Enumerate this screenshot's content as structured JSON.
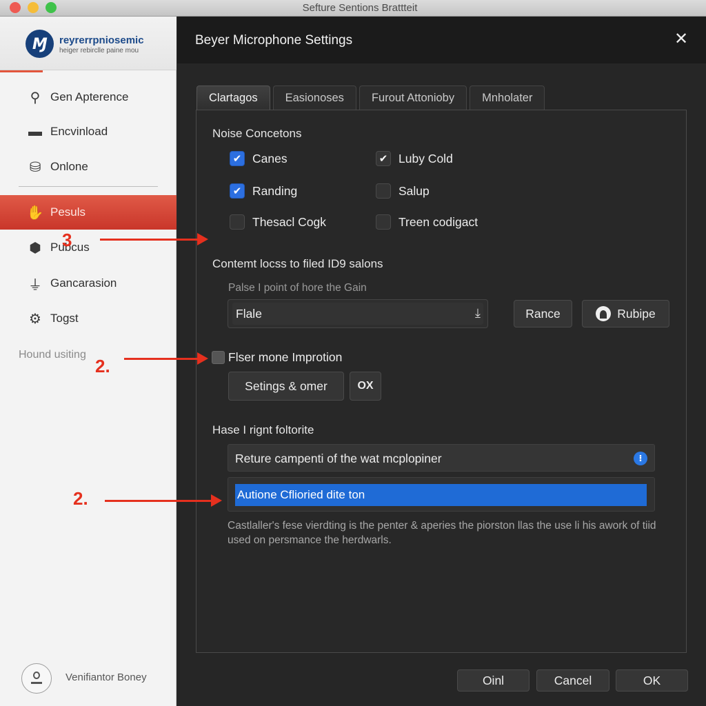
{
  "window": {
    "title": "Sefture Sentions Brattteit"
  },
  "sidebar": {
    "brand": {
      "logo_text": "Ɱ",
      "name": "reyrerrpniosemic",
      "tagline": "heiger rebirclle paine mou"
    },
    "items": [
      {
        "label": "Gen Apterence",
        "icon": "search-icon",
        "glyph": "⚲",
        "active": false
      },
      {
        "label": "Encvinload",
        "icon": "calendar-icon",
        "glyph": "▬",
        "active": false
      },
      {
        "label": "Onlone",
        "icon": "database-icon",
        "glyph": "⛁",
        "active": false
      },
      {
        "label": "Pesuls",
        "icon": "hand-icon",
        "glyph": "✋",
        "active": true
      },
      {
        "label": "Pubcus",
        "icon": "box-icon",
        "glyph": "⬢",
        "active": false
      },
      {
        "label": "Gancarasion",
        "icon": "microphone-icon",
        "glyph": "⏚",
        "active": false
      },
      {
        "label": "Togst",
        "icon": "gear-icon",
        "glyph": "⚙",
        "active": false
      }
    ],
    "muted_label": "Hound usiting",
    "user": {
      "name": "Venifiantor Boney"
    }
  },
  "dialog": {
    "title": "Beyer Microphone Settings",
    "close_glyph": "✕",
    "tabs": [
      {
        "label": "Clartagos",
        "active": true
      },
      {
        "label": "Easionoses",
        "active": false
      },
      {
        "label": "Furout Attonioby",
        "active": false
      },
      {
        "label": "Mnholater",
        "active": false
      }
    ],
    "noise": {
      "title": "Noise Concetons",
      "checkboxes": [
        {
          "label": "Canes",
          "checked": true,
          "style": "blue"
        },
        {
          "label": "Luby Cold",
          "checked": true,
          "style": "dark"
        },
        {
          "label": "Randing",
          "checked": true,
          "style": "blue"
        },
        {
          "label": "Salup",
          "checked": false,
          "style": "dark"
        },
        {
          "label": "Thesacl Cogk",
          "checked": false,
          "style": "dark"
        },
        {
          "label": "Treen codigact",
          "checked": false,
          "style": "dark"
        }
      ],
      "check_glyph": "✔"
    },
    "content": {
      "title": "Contemt locss to filed ID9 salons",
      "sublabel": "Palse I point of hore the Gain",
      "select_value": "Flale",
      "select_arrow": "⤓",
      "rance_label": "Rance",
      "rubipe_label": "Rubipe"
    },
    "improvement": {
      "checkbox_label": "Flser mone Improtion",
      "checked": false,
      "settings_label": "Setings & omer",
      "ox_label": "OX"
    },
    "right": {
      "title": "Hase I rignt foltorite",
      "info_value": "Reture campenti of the wat mcplopiner",
      "info_glyph": "⁝",
      "selected_item": "Autione Cflioried dite ton",
      "description": "Castlaller's fese vierdting is the penter & aperies the piorston llas the use li his awork of tiid used on persmance the herdwarls."
    },
    "footer": {
      "button1_label": "Oinl",
      "cancel_label": "Cancel",
      "ok_label": "OK"
    }
  },
  "annotations": [
    {
      "label": "3"
    },
    {
      "label": "2."
    },
    {
      "label": "2."
    }
  ],
  "colors": {
    "accent_red": "#e05a47",
    "selection_blue": "#1f6bd6",
    "checkbox_blue": "#2c6fe0",
    "annotation_red": "#e5301e"
  }
}
